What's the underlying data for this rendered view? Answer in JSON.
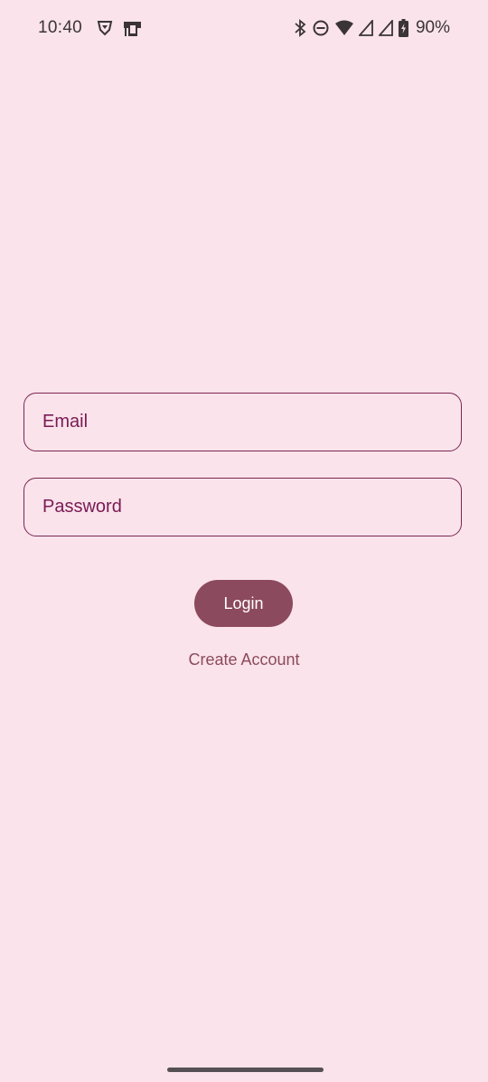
{
  "status_bar": {
    "time": "10:40",
    "left_icons": [
      "brave-shield-icon",
      "screen-cast-icon"
    ],
    "right_icons": [
      "bluetooth-icon",
      "do-not-disturb-icon",
      "wifi-icon",
      "cell-signal-icon",
      "cell-signal-icon",
      "battery-charging-icon"
    ],
    "battery": "90%"
  },
  "form": {
    "email_placeholder": "Email",
    "password_placeholder": "Password",
    "login_label": "Login",
    "create_account_label": "Create Account"
  },
  "colors": {
    "background": "#fae3ea",
    "accent": "#8c4a5e",
    "field_border": "#7a2552",
    "field_text": "#7a1a55"
  }
}
